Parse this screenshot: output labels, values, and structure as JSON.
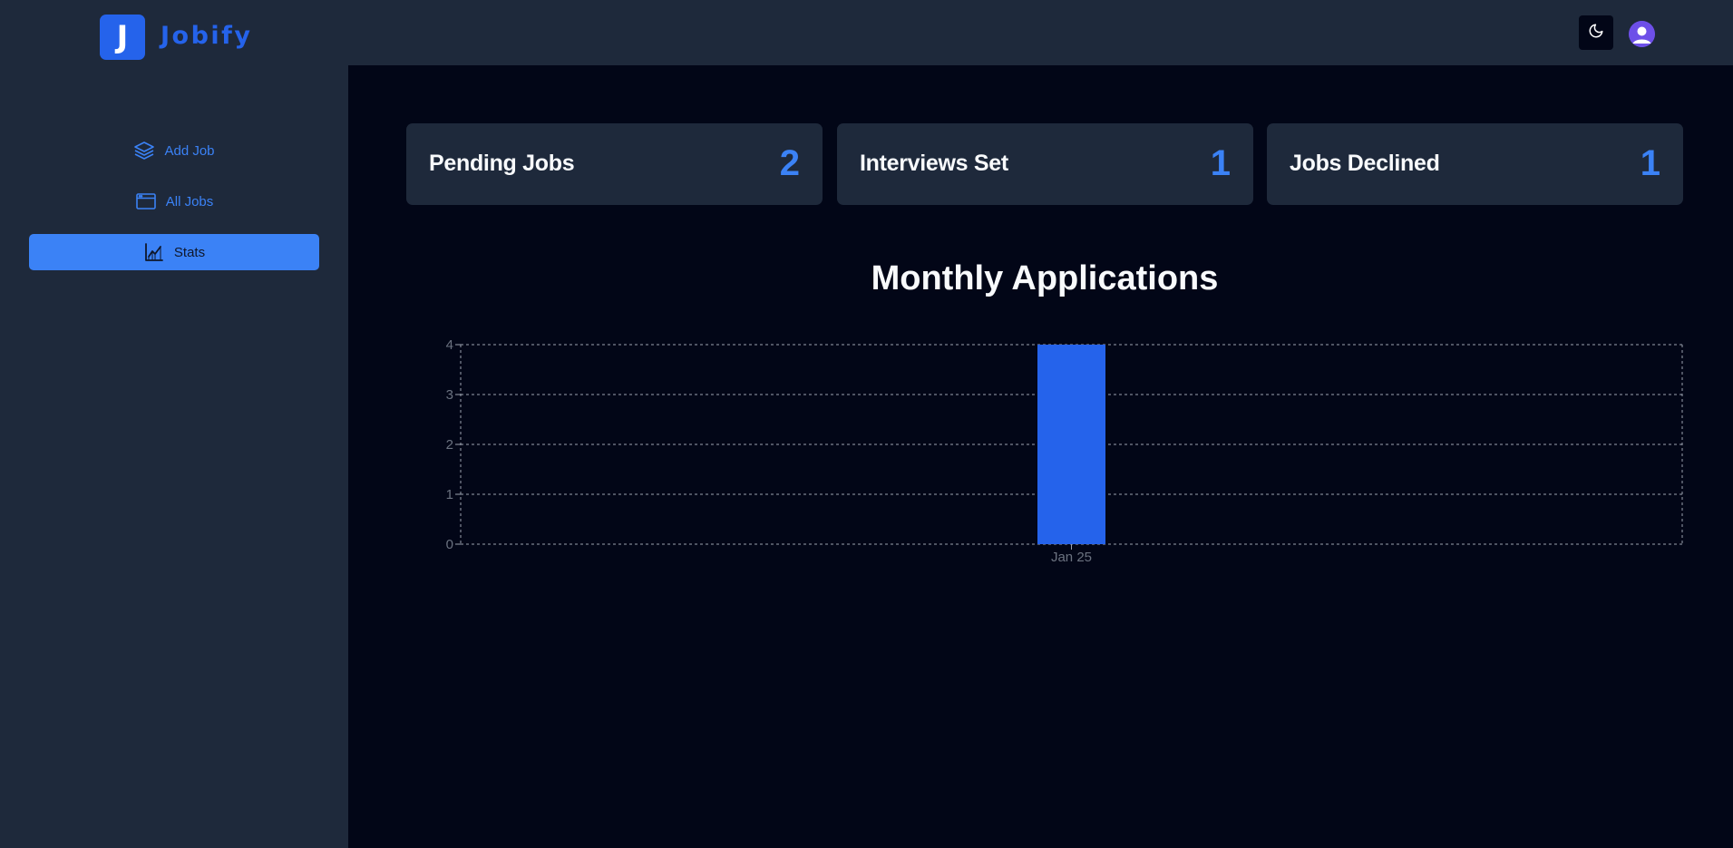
{
  "header": {
    "logo_letter": "J",
    "app_name": "Jobify",
    "theme_toggle_icon": "moon-icon",
    "avatar_icon": "user-avatar-icon"
  },
  "sidebar": {
    "items": [
      {
        "label": "Add Job",
        "icon": "layers-icon",
        "active": false
      },
      {
        "label": "All Jobs",
        "icon": "browser-window-icon",
        "active": false
      },
      {
        "label": "Stats",
        "icon": "area-chart-icon",
        "active": true
      }
    ]
  },
  "stats": [
    {
      "label": "Pending Jobs",
      "value": "2"
    },
    {
      "label": "Interviews Set",
      "value": "1"
    },
    {
      "label": "Jobs Declined",
      "value": "1"
    }
  ],
  "colors": {
    "accent": "#3b82f6",
    "bar": "#2563eb",
    "panel": "#1e293b",
    "background": "#020617"
  },
  "chart_data": {
    "type": "bar",
    "title": "Monthly Applications",
    "categories": [
      "Jan 25"
    ],
    "values": [
      4
    ],
    "ylim": [
      0,
      4
    ],
    "yticks": [
      0,
      1,
      2,
      3,
      4
    ],
    "grid": true,
    "xlabel": "",
    "ylabel": ""
  }
}
